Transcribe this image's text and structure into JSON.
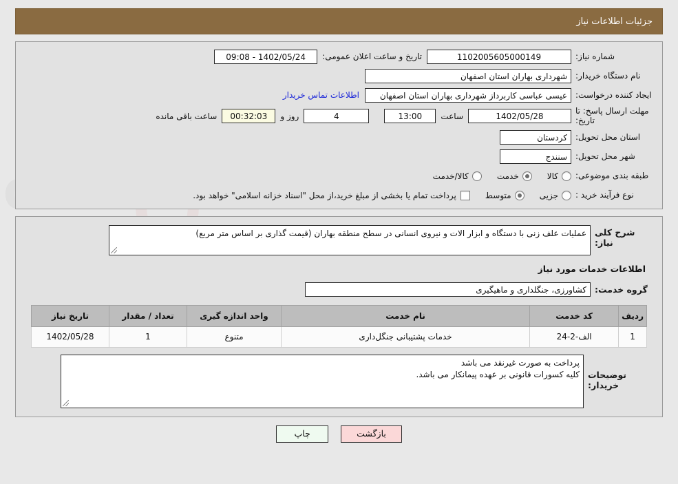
{
  "header": {
    "title": "جزئیات اطلاعات نیاز"
  },
  "form": {
    "need_number_label": "شماره نیاز:",
    "need_number_value": "1102005605000149",
    "announce_label": "تاریخ و ساعت اعلان عمومی:",
    "announce_value": "1402/05/24 - 09:08",
    "buyer_org_label": "نام دستگاه خریدار:",
    "buyer_org_value": "شهرداری بهاران استان اصفهان",
    "creator_label": "ایجاد کننده درخواست:",
    "creator_value": "عیسی عباسی کاربرداز شهرداری بهاران استان اصفهان",
    "contact_link": "اطلاعات تماس خریدار",
    "deadline_label": "مهلت ارسال پاسخ: تا تاریخ:",
    "deadline_date": "1402/05/28",
    "hour_label": "ساعت",
    "deadline_time": "13:00",
    "remaining_days": "4",
    "days_and_label": "روز و",
    "remaining_time": "00:32:03",
    "remaining_suffix": "ساعت باقی مانده",
    "province_label": "استان محل تحویل:",
    "province_value": "کردستان",
    "city_label": "شهر محل تحویل:",
    "city_value": "سنندج",
    "category_label": "طبقه بندی موضوعی:",
    "category_options": [
      {
        "label": "کالا",
        "selected": false
      },
      {
        "label": "خدمت",
        "selected": true
      },
      {
        "label": "کالا/خدمت",
        "selected": false
      }
    ],
    "process_label": "نوع فرآیند خرید :",
    "process_options": [
      {
        "label": "جزیی",
        "selected": false
      },
      {
        "label": "متوسط",
        "selected": true
      }
    ],
    "treasury_note": "پرداخت تمام یا بخشی از مبلغ خرید،از محل \"اسناد خزانه اسلامی\" خواهد بود.",
    "treasury_checked": false
  },
  "main": {
    "desc_label": "شرح کلی نیاز:",
    "desc_value": "عملیات علف زنی با دستگاه و ابزار الات و نیروی انسانی در سطح منطقه بهاران (قیمت گذاری بر اساس متر مربع)",
    "services_title": "اطلاعات خدمات مورد نیاز",
    "group_label": "گروه خدمت:",
    "group_value": "کشاورزی، جنگلداری و ماهیگیری",
    "table": {
      "columns": [
        "ردیف",
        "کد خدمت",
        "نام خدمت",
        "واحد اندازه گیری",
        "تعداد / مقدار",
        "تاریخ نیاز"
      ],
      "rows": [
        {
          "radif": "1",
          "code": "الف-2-24",
          "name": "خدمات پشتیبانی جنگل‌داری",
          "unit": "متنوع",
          "qty": "1",
          "date": "1402/05/28"
        }
      ]
    },
    "notes_label": "توضیحات خریدار:",
    "notes_value": "پرداخت به صورت غیرنقد می باشد\nکلیه کسورات قانونی بر عهده پیمانکار می باشد."
  },
  "footer": {
    "print_label": "چاپ",
    "back_label": "بازگشت"
  }
}
